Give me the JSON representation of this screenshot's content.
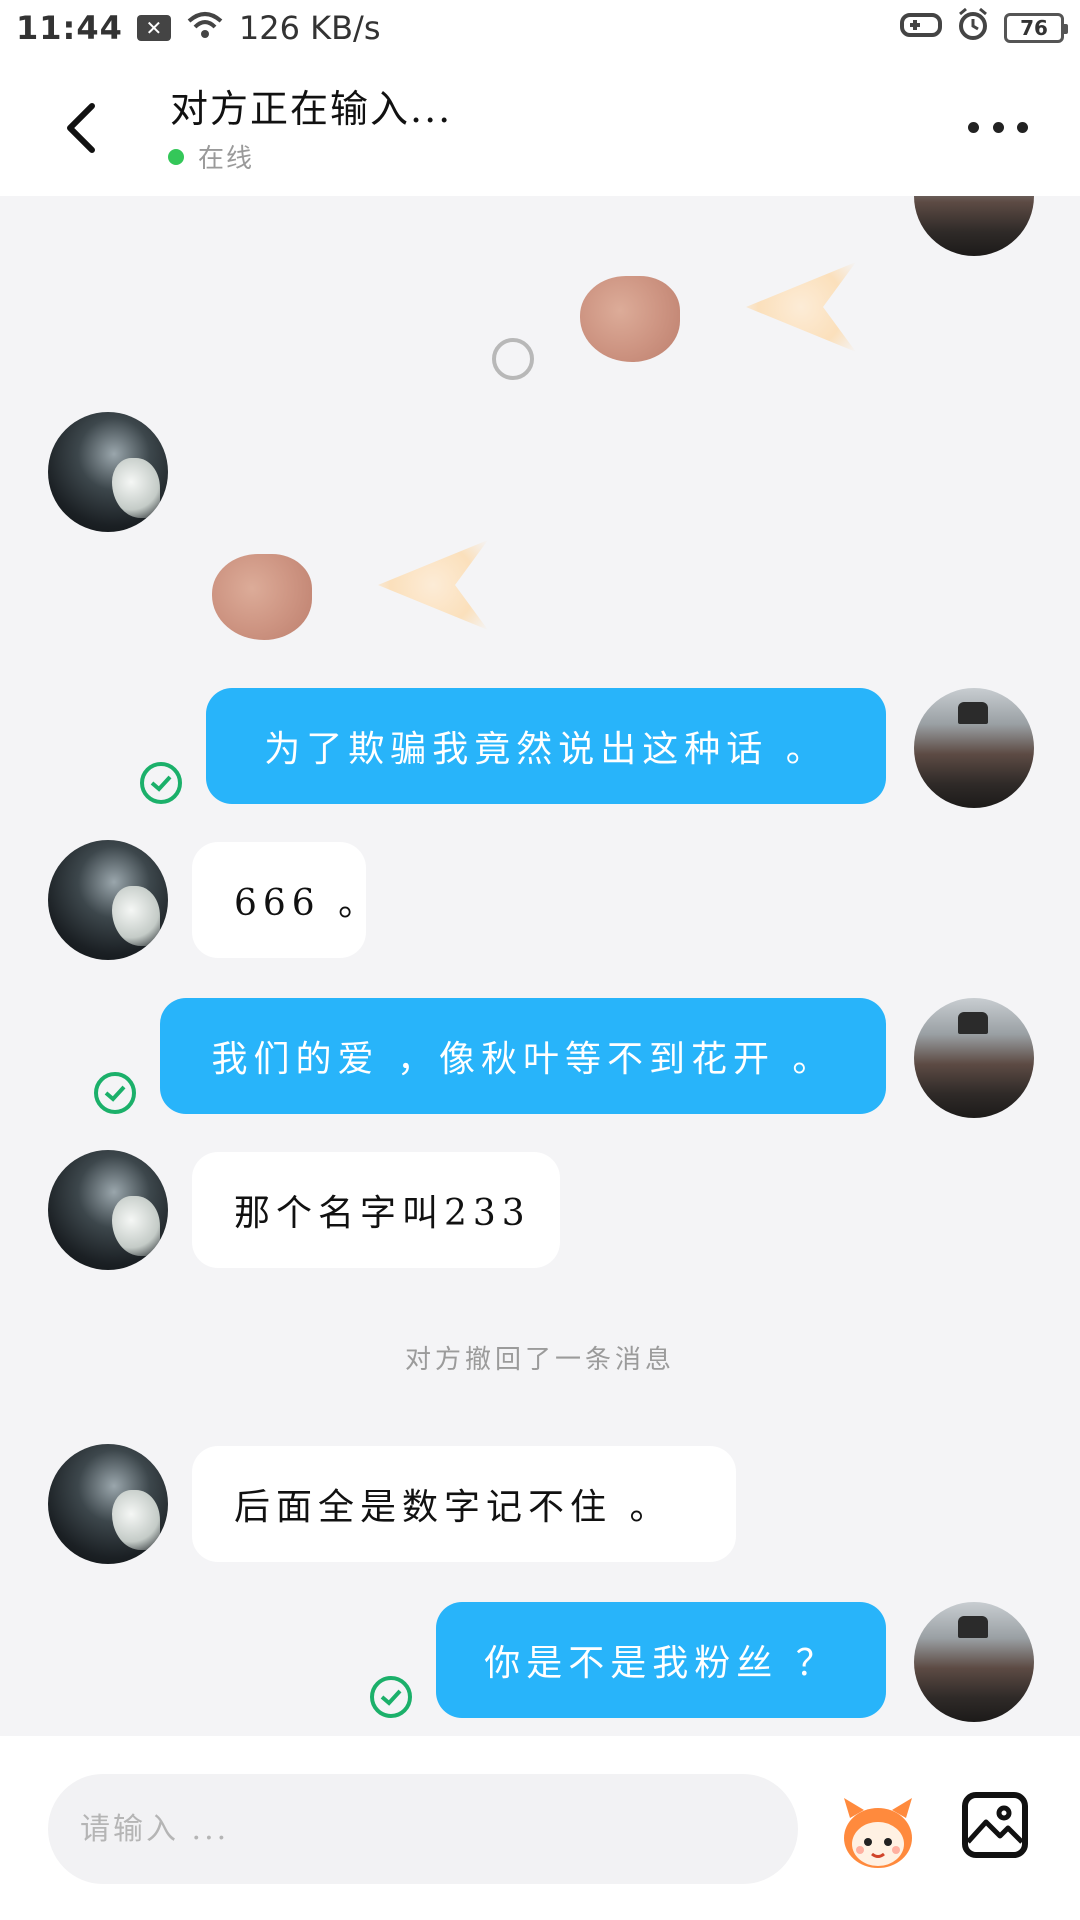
{
  "status_bar": {
    "time": "11:44",
    "network_speed": "126 KB/s",
    "battery": "76",
    "icons": [
      "notification-off-icon",
      "wifi-icon",
      "game-controller-icon",
      "alarm-icon",
      "battery-icon"
    ]
  },
  "header": {
    "title": "对方正在输入...",
    "presence": "在线",
    "presence_color": "#34c759",
    "back_icon": "chevron-left-icon",
    "more_icon": "more-dots-icon"
  },
  "messages": [
    {
      "from": "other",
      "text": "666 。"
    },
    {
      "from": "me",
      "text": "为了欺骗我竟然说出这种话 。",
      "read": true
    },
    {
      "from": "me",
      "text": "我们的爱 ，像秋叶等不到花开 。",
      "read": true
    },
    {
      "from": "other",
      "text": "那个名字叫233"
    },
    {
      "from": "other",
      "text": "后面全是数字记不住 。"
    },
    {
      "from": "me",
      "text": "你是不是我粉丝 ？",
      "read": true
    }
  ],
  "system_notice": "对方撤回了一条消息",
  "input": {
    "placeholder": "请输入 ..."
  },
  "colors": {
    "my_bubble": "#28b4fa",
    "other_bubble": "#ffffff",
    "read_check": "#1bb06a",
    "chat_bg": "#f4f4f6"
  }
}
